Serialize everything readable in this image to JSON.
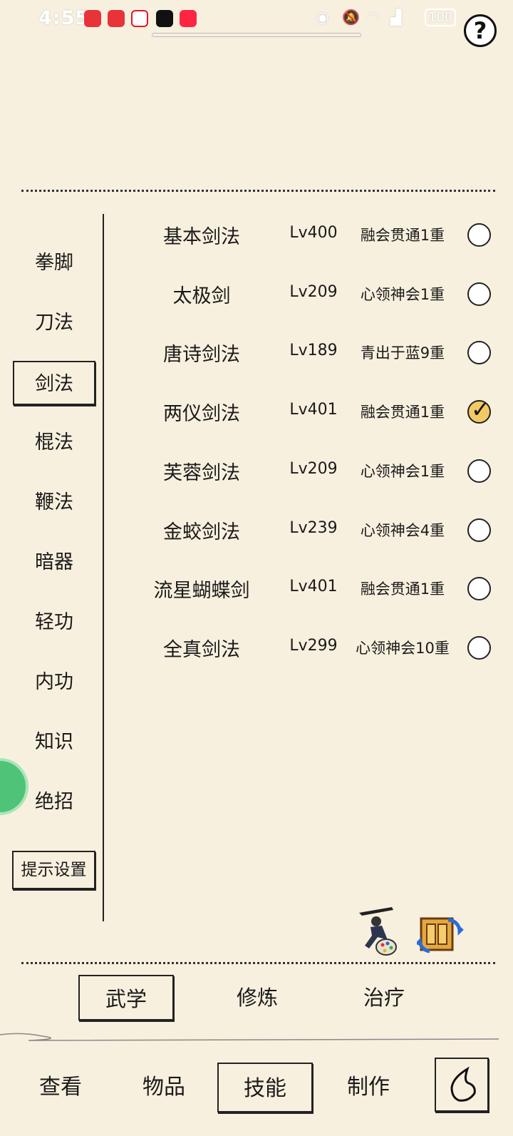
{
  "status_bar": {
    "time": "4:55",
    "battery": "100",
    "apps": [
      {
        "name": "huawei-app-icon",
        "color": "#e8333a"
      },
      {
        "name": "huawei-app-icon",
        "color": "#e8333a"
      },
      {
        "name": "weibo-icon",
        "color": "#e6162d"
      },
      {
        "name": "tiktok-icon",
        "color": "#111111"
      },
      {
        "name": "xiaohongshu-icon",
        "color": "#ff2442"
      }
    ]
  },
  "help_label": "?",
  "categories": [
    {
      "label": "拳脚",
      "active": false
    },
    {
      "label": "刀法",
      "active": false
    },
    {
      "label": "剑法",
      "active": true
    },
    {
      "label": "棍法",
      "active": false
    },
    {
      "label": "鞭法",
      "active": false
    },
    {
      "label": "暗器",
      "active": false
    },
    {
      "label": "轻功",
      "active": false
    },
    {
      "label": "内功",
      "active": false
    },
    {
      "label": "知识",
      "active": false
    },
    {
      "label": "绝招",
      "active": false
    }
  ],
  "hint_settings_label": "提示设置",
  "skills": [
    {
      "name": "基本剑法",
      "level": "Lv400",
      "rank": "融会贯通1重",
      "checked": false
    },
    {
      "name": "太极剑",
      "level": "Lv209",
      "rank": "心领神会1重",
      "checked": false
    },
    {
      "name": "唐诗剑法",
      "level": "Lv189",
      "rank": "青出于蓝9重",
      "checked": false
    },
    {
      "name": "两仪剑法",
      "level": "Lv401",
      "rank": "融会贯通1重",
      "checked": true
    },
    {
      "name": "芙蓉剑法",
      "level": "Lv209",
      "rank": "心领神会1重",
      "checked": false
    },
    {
      "name": "金蛟剑法",
      "level": "Lv239",
      "rank": "心领神会4重",
      "checked": false
    },
    {
      "name": "流星蝴蝶剑",
      "level": "Lv401",
      "rank": "融会贯通1重",
      "checked": false
    },
    {
      "name": "全真剑法",
      "level": "Lv299",
      "rank": "心领神会10重",
      "checked": false
    }
  ],
  "sub_tabs": [
    {
      "label": "武学",
      "active": true
    },
    {
      "label": "修炼",
      "active": false
    },
    {
      "label": "治疗",
      "active": false
    }
  ],
  "nav": [
    {
      "label": "查看",
      "active": false
    },
    {
      "label": "物品",
      "active": false
    },
    {
      "label": "技能",
      "active": true
    },
    {
      "label": "制作",
      "active": false
    }
  ],
  "colors": {
    "background": "#f8f0de",
    "check_on": "#f3c963",
    "badge": "#4fc478"
  }
}
